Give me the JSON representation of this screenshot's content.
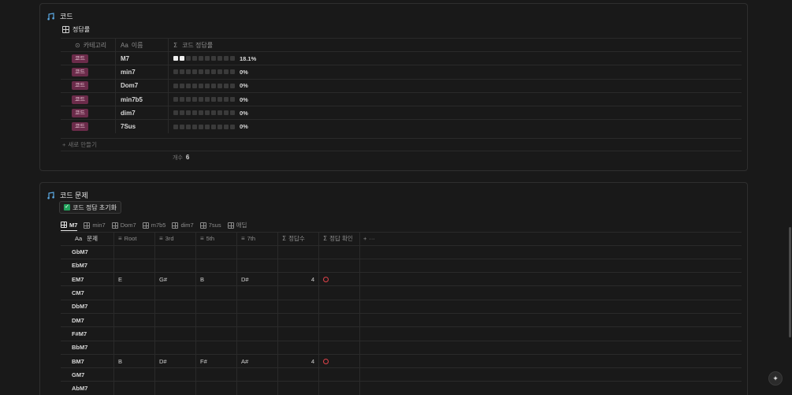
{
  "card1": {
    "title": "코드",
    "view_label": "정답률",
    "headers": {
      "category": "카테고리",
      "name": "이름",
      "rate": "코드 정답률",
      "aa": "Aa",
      "sigma": "Σ"
    },
    "rows": [
      {
        "tag": "코드",
        "name": "M7",
        "rate": "18.1%",
        "filled": 2
      },
      {
        "tag": "코드",
        "name": "min7",
        "rate": "0%",
        "filled": 0
      },
      {
        "tag": "코드",
        "name": "Dom7",
        "rate": "0%",
        "filled": 0
      },
      {
        "tag": "코드",
        "name": "min7b5",
        "rate": "0%",
        "filled": 0
      },
      {
        "tag": "코드",
        "name": "dim7",
        "rate": "0%",
        "filled": 0
      },
      {
        "tag": "코드",
        "name": "7Sus",
        "rate": "0%",
        "filled": 0
      }
    ],
    "new_label": "새로 만들기",
    "count_label": "개수",
    "count_value": "6"
  },
  "card2": {
    "title": "코드 문제",
    "reset_button": "코드 정답 초기화",
    "tabs": [
      "M7",
      "min7",
      "Dom7",
      "m7b5",
      "dim7",
      "7sus",
      "애딥"
    ],
    "headers": {
      "problem": "문제",
      "aa": "Aa",
      "root": "Root",
      "third": "3rd",
      "fifth": "5th",
      "seventh": "7th",
      "count": "정답수",
      "check": "정답 확인",
      "sigma": "Σ",
      "add": "+",
      "more": "···"
    },
    "rows": [
      {
        "problem": "GbM7",
        "root": "",
        "third": "",
        "fifth": "",
        "seventh": "",
        "count": "",
        "ok": false
      },
      {
        "problem": "EbM7",
        "root": "",
        "third": "",
        "fifth": "",
        "seventh": "",
        "count": "",
        "ok": false
      },
      {
        "problem": "EM7",
        "root": "E",
        "third": "G#",
        "fifth": "B",
        "seventh": "D#",
        "count": "4",
        "ok": true
      },
      {
        "problem": "CM7",
        "root": "",
        "third": "",
        "fifth": "",
        "seventh": "",
        "count": "",
        "ok": false
      },
      {
        "problem": "DbM7",
        "root": "",
        "third": "",
        "fifth": "",
        "seventh": "",
        "count": "",
        "ok": false
      },
      {
        "problem": "DM7",
        "root": "",
        "third": "",
        "fifth": "",
        "seventh": "",
        "count": "",
        "ok": false
      },
      {
        "problem": "F#M7",
        "root": "",
        "third": "",
        "fifth": "",
        "seventh": "",
        "count": "",
        "ok": false
      },
      {
        "problem": "BbM7",
        "root": "",
        "third": "",
        "fifth": "",
        "seventh": "",
        "count": "",
        "ok": false
      },
      {
        "problem": "BM7",
        "root": "B",
        "third": "D#",
        "fifth": "F#",
        "seventh": "A#",
        "count": "4",
        "ok": true
      },
      {
        "problem": "GM7",
        "root": "",
        "third": "",
        "fifth": "",
        "seventh": "",
        "count": "",
        "ok": false
      },
      {
        "problem": "AbM7",
        "root": "",
        "third": "",
        "fifth": "",
        "seventh": "",
        "count": "",
        "ok": false
      }
    ]
  },
  "colors": {
    "tag_bg": "#6b2b4a",
    "check_circle": "#e0424a",
    "accent": "#5aa7e0"
  },
  "fab_icon": "sparkle-icon"
}
